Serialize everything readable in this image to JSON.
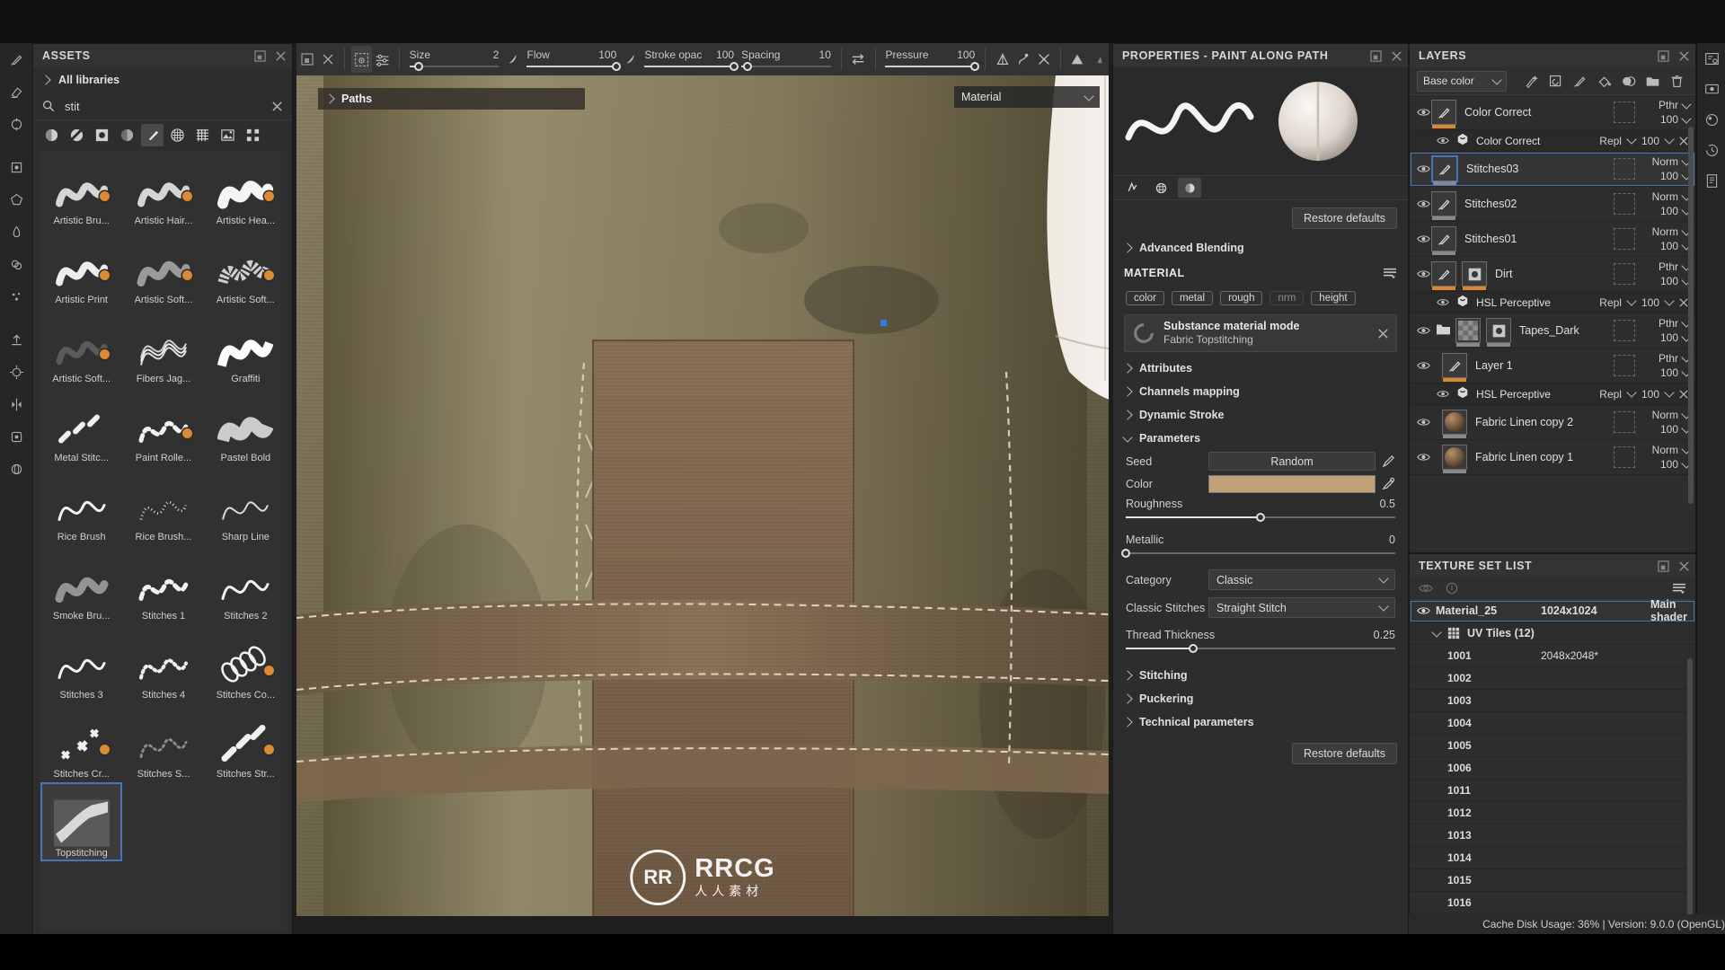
{
  "app": {
    "status": "Cache Disk Usage:   36% | Version: 9.0.0 (OpenGL)"
  },
  "left_rail": {
    "items": [
      "paint-brush-tool",
      "eraser-tool",
      "projection-tool",
      "geometry-decal-tool",
      "polygon-fill-tool",
      "smudge-tool",
      "clone-tool",
      "particle-tool",
      "export-tool",
      "bake-tool",
      "symmetry-tool",
      "plugin-tool",
      "sphere-tool"
    ]
  },
  "assets": {
    "title": "ASSETS",
    "library_label": "All libraries",
    "search_value": "stit",
    "search_placeholder": "Search",
    "filters": [
      "material-filter-icon",
      "smartmaterial-filter-icon",
      "mask-filter-icon",
      "smartmask-filter-icon",
      "brush-filter-icon",
      "alpha-filter-icon",
      "texture-filter-icon",
      "environment-filter-icon",
      "grid-view-icon"
    ],
    "selected_filter_index": 4,
    "items": [
      {
        "label": "Artistic Bru...",
        "kind": "wave-soft",
        "substance": true
      },
      {
        "label": "Artistic Hair...",
        "kind": "wave-soft",
        "substance": true
      },
      {
        "label": "Artistic Hea...",
        "kind": "wave-thick",
        "substance": true
      },
      {
        "label": "Artistic Print",
        "kind": "wave-print",
        "substance": true
      },
      {
        "label": "Artistic Soft...",
        "kind": "wave-faint",
        "substance": true
      },
      {
        "label": "Artistic Soft...",
        "kind": "wave-noisy",
        "substance": true
      },
      {
        "label": "Artistic Soft...",
        "kind": "wave-vfaint",
        "substance": true
      },
      {
        "label": "Fibers Jag...",
        "kind": "wave-fibers",
        "substance": false
      },
      {
        "label": "Graffiti",
        "kind": "wave-graffiti",
        "substance": false
      },
      {
        "label": "Metal Stitc...",
        "kind": "dashes-diag",
        "substance": false
      },
      {
        "label": "Paint Rolle...",
        "kind": "wave-dashed",
        "substance": true
      },
      {
        "label": "Pastel Bold",
        "kind": "wave-pastel",
        "substance": false
      },
      {
        "label": "Rice Brush",
        "kind": "wave-thin",
        "substance": false
      },
      {
        "label": "Rice Brush...",
        "kind": "wave-dotty",
        "substance": false
      },
      {
        "label": "Sharp Line",
        "kind": "wave-sharp",
        "substance": false
      },
      {
        "label": "Smoke Bru...",
        "kind": "wave-smoke",
        "substance": false
      },
      {
        "label": "Stitches 1",
        "kind": "wave-dashed",
        "substance": false
      },
      {
        "label": "Stitches 2",
        "kind": "wave-thin",
        "substance": false
      },
      {
        "label": "Stitches 3",
        "kind": "wave-thin",
        "substance": false
      },
      {
        "label": "Stitches 4",
        "kind": "wave-dotted",
        "substance": false
      },
      {
        "label": "Stitches Co...",
        "kind": "coil",
        "substance": true
      },
      {
        "label": "Stitches Cr...",
        "kind": "cross",
        "substance": true
      },
      {
        "label": "Stitches S...",
        "kind": "wave-dotted-faint",
        "substance": false
      },
      {
        "label": "Stitches Str...",
        "kind": "dashes-diag2",
        "substance": true
      },
      {
        "label": "Topstitching",
        "kind": "topstitch",
        "substance": false,
        "selected": true
      }
    ],
    "footer": {
      "left_icons": [
        "list-view-icon",
        "detail-view-icon"
      ],
      "right_icons": [
        "refresh-icon",
        "import-icon",
        "add-icon"
      ]
    }
  },
  "brush_toolbar": {
    "icons_left": [
      "paint-along-path-icon",
      "brush-settings-icon"
    ],
    "size": {
      "label": "Size",
      "value": "2",
      "pct": 10
    },
    "flow": {
      "label": "Flow",
      "value": "100",
      "pct": 100
    },
    "stroke_opacity": {
      "label": "Stroke opac",
      "value": "100",
      "pct": 100
    },
    "spacing": {
      "label": "Spacing",
      "value": "10",
      "pct": 7
    },
    "pressure": {
      "label": "Pressure",
      "value": "100",
      "pct": 100
    },
    "icons_right": [
      "swap-icon",
      "symmetry-icon",
      "mirror-icon",
      "lazy-mouse-icon",
      "tiling-icon"
    ]
  },
  "viewport": {
    "path_bar_label": "Paths",
    "material_dropdown": "Material"
  },
  "properties": {
    "title": "PROPERTIES - PAINT ALONG PATH",
    "preview_tabs": [
      "flow-tab",
      "alpha-tab",
      "material-tab"
    ],
    "selected_preview_tab": 2,
    "restore_defaults_top": "Restore defaults",
    "advanced_blending": "Advanced Blending",
    "material_header": "MATERIAL",
    "channels": [
      "color",
      "metal",
      "rough",
      "nrm",
      "height"
    ],
    "channels_enabled": [
      true,
      true,
      true,
      false,
      true
    ],
    "substance_mode_title": "Substance material mode",
    "substance_mode_value": "Fabric Topstitching",
    "sections": [
      "Attributes",
      "Channels mapping",
      "Dynamic Stroke"
    ],
    "parameters_header": "Parameters",
    "params": {
      "seed_label": "Seed",
      "seed_value": "Random",
      "color_label": "Color",
      "color_value": "#c2a078",
      "roughness_label": "Roughness",
      "roughness_value": "0.5",
      "roughness_pct": 50,
      "metallic_label": "Metallic",
      "metallic_value": "0",
      "metallic_pct": 0,
      "category_label": "Category",
      "category_value": "Classic",
      "classic_stitches_label": "Classic Stitches",
      "classic_stitches_value": "Straight Stitch",
      "thread_thickness_label": "Thread Thickness",
      "thread_thickness_value": "0.25",
      "thread_thickness_pct": 25
    },
    "sections_bottom": [
      "Stitching",
      "Puckering",
      "Technical parameters"
    ],
    "restore_defaults_bottom": "Restore defaults"
  },
  "layers": {
    "title": "LAYERS",
    "channel_selector": "Base color",
    "tool_icons": [
      "add-effect-icon",
      "add-adjustment-icon",
      "add-paint-layer-icon",
      "add-fill-layer-icon",
      "add-mask-icon",
      "add-folder-icon",
      "delete-layer-icon"
    ],
    "items": [
      {
        "type": "layer",
        "name": "Color Correct",
        "blend": "Pthr",
        "opacity": "100",
        "thumb": "brush",
        "underbar": "orange",
        "mask": true
      },
      {
        "type": "effect",
        "name": "Color Correct",
        "blend": "Repl",
        "opacity": "100"
      },
      {
        "type": "layer",
        "name": "Stitches03",
        "blend": "Norm",
        "opacity": "100",
        "thumb": "brush",
        "underbar": "grey",
        "mask": true,
        "selected": true
      },
      {
        "type": "layer",
        "name": "Stitches02",
        "blend": "Norm",
        "opacity": "100",
        "thumb": "brush",
        "underbar": "grey",
        "mask": true
      },
      {
        "type": "layer",
        "name": "Stitches01",
        "blend": "Norm",
        "opacity": "100",
        "thumb": "brush",
        "underbar": "grey",
        "mask": true
      },
      {
        "type": "layer",
        "name": "Dirt",
        "blend": "Pthr",
        "opacity": "100",
        "thumb": "brush",
        "thumb2": "mask",
        "underbar": "orange",
        "mask": true
      },
      {
        "type": "effect",
        "name": "HSL Perceptive",
        "blend": "Repl",
        "opacity": "100"
      },
      {
        "type": "folder",
        "name": "Tapes_Dark",
        "blend": "Pthr",
        "opacity": "100",
        "thumb": "checker",
        "thumb2": "mask",
        "underbar": "grey",
        "mask": true
      },
      {
        "type": "layer",
        "name": "Layer 1",
        "blend": "Pthr",
        "opacity": "100",
        "thumb": "brush",
        "underbar": "orange",
        "mask": true,
        "indent": true
      },
      {
        "type": "effect",
        "name": "HSL Perceptive",
        "blend": "Repl",
        "opacity": "100"
      },
      {
        "type": "layer",
        "name": "Fabric Linen copy 2",
        "blend": "Norm",
        "opacity": "100",
        "thumb": "sphere",
        "underbar": "grey",
        "mask": true,
        "indent": true
      },
      {
        "type": "layer",
        "name": "Fabric Linen copy 1",
        "blend": "Norm",
        "opacity": "100",
        "thumb": "sphere",
        "underbar": "grey",
        "mask": true,
        "indent": true
      }
    ]
  },
  "texture_set_list": {
    "title": "TEXTURE SET LIST",
    "toolbar_icons": [
      "visibility-icon",
      "info-icon",
      "menu-icon"
    ],
    "material": {
      "name": "Material_25",
      "resolution": "1024x1024",
      "shader": "Main shader"
    },
    "uv_tiles_label": "UV Tiles (12)",
    "tiles": [
      {
        "id": "1001",
        "res": "2048x2048*"
      },
      {
        "id": "1002",
        "res": ""
      },
      {
        "id": "1003",
        "res": ""
      },
      {
        "id": "1004",
        "res": ""
      },
      {
        "id": "1005",
        "res": ""
      },
      {
        "id": "1006",
        "res": ""
      },
      {
        "id": "1011",
        "res": ""
      },
      {
        "id": "1012",
        "res": ""
      },
      {
        "id": "1013",
        "res": ""
      },
      {
        "id": "1014",
        "res": ""
      },
      {
        "id": "1015",
        "res": ""
      },
      {
        "id": "1016",
        "res": ""
      }
    ]
  },
  "right_rail": {
    "items": [
      "texture-set-settings-icon",
      "display-settings-icon",
      "shader-settings-icon",
      "history-icon",
      "shelf-icon"
    ]
  },
  "watermark": {
    "logo": "RR",
    "title": "RRCG",
    "subtitle": "人人素材"
  }
}
